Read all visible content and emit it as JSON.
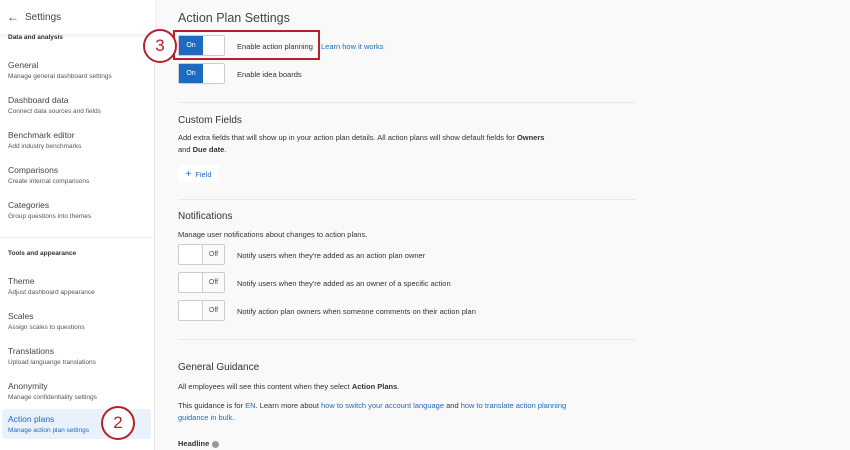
{
  "sidebar": {
    "header": "Settings",
    "sections": [
      {
        "title": "Data and analysis",
        "items": [
          {
            "title": "General",
            "subtitle": "Manage general dashboard settings"
          },
          {
            "title": "Dashboard data",
            "subtitle": "Connect data sources and fields"
          },
          {
            "title": "Benchmark editor",
            "subtitle": "Add industry benchmarks"
          },
          {
            "title": "Comparisons",
            "subtitle": "Create internal comparisons"
          },
          {
            "title": "Categories",
            "subtitle": "Group questions into themes"
          }
        ]
      },
      {
        "title": "Tools and appearance",
        "items": [
          {
            "title": "Theme",
            "subtitle": "Adjust dashboard appearance"
          },
          {
            "title": "Scales",
            "subtitle": "Assign scales to questions"
          },
          {
            "title": "Translations",
            "subtitle": "Upload languange translations"
          },
          {
            "title": "Anonymity",
            "subtitle": "Manage confidentiality settings"
          },
          {
            "title": "Action plans",
            "subtitle": "Manage action plan settings"
          }
        ]
      }
    ]
  },
  "main": {
    "title": "Action Plan Settings",
    "toggles": [
      {
        "state": "On",
        "label": "Enable action planning",
        "link": "Learn how it works"
      },
      {
        "state": "On",
        "label": "Enable idea boards"
      }
    ],
    "custom_fields": {
      "title": "Custom Fields",
      "desc1": "Add extra fields that will show up in your action plan details. All action plans will show default fields for ",
      "b1": "Owners",
      "desc2": " and ",
      "b2": "Due date",
      "desc3": ".",
      "button": "Field"
    },
    "notifications": {
      "title": "Notifications",
      "desc": "Manage user notifications about changes to action plans.",
      "items": [
        {
          "state": "Off",
          "label": "Notify users when they're added as an action plan owner"
        },
        {
          "state": "Off",
          "label": "Notify users when they're added as an owner of a specific action"
        },
        {
          "state": "Off",
          "label": "Notify action plan owners when someone comments on their action plan"
        }
      ]
    },
    "guidance": {
      "title": "General Guidance",
      "desc1": "All employees will see this content when they select ",
      "b1": "Action Plans",
      "desc1_end": ".",
      "p2a": "This guidance is for ",
      "lang": "EN",
      "p2b": ". Learn more about ",
      "link1": "how to switch your account language",
      "p2c": " and ",
      "link2": "how to translate action planning guidance in bulk",
      "p2d": ".",
      "headline": "Headline"
    }
  },
  "callouts": {
    "a": "2",
    "b": "3"
  },
  "colors": {
    "accent": "#1f6ac1",
    "callout": "#b5202e"
  }
}
